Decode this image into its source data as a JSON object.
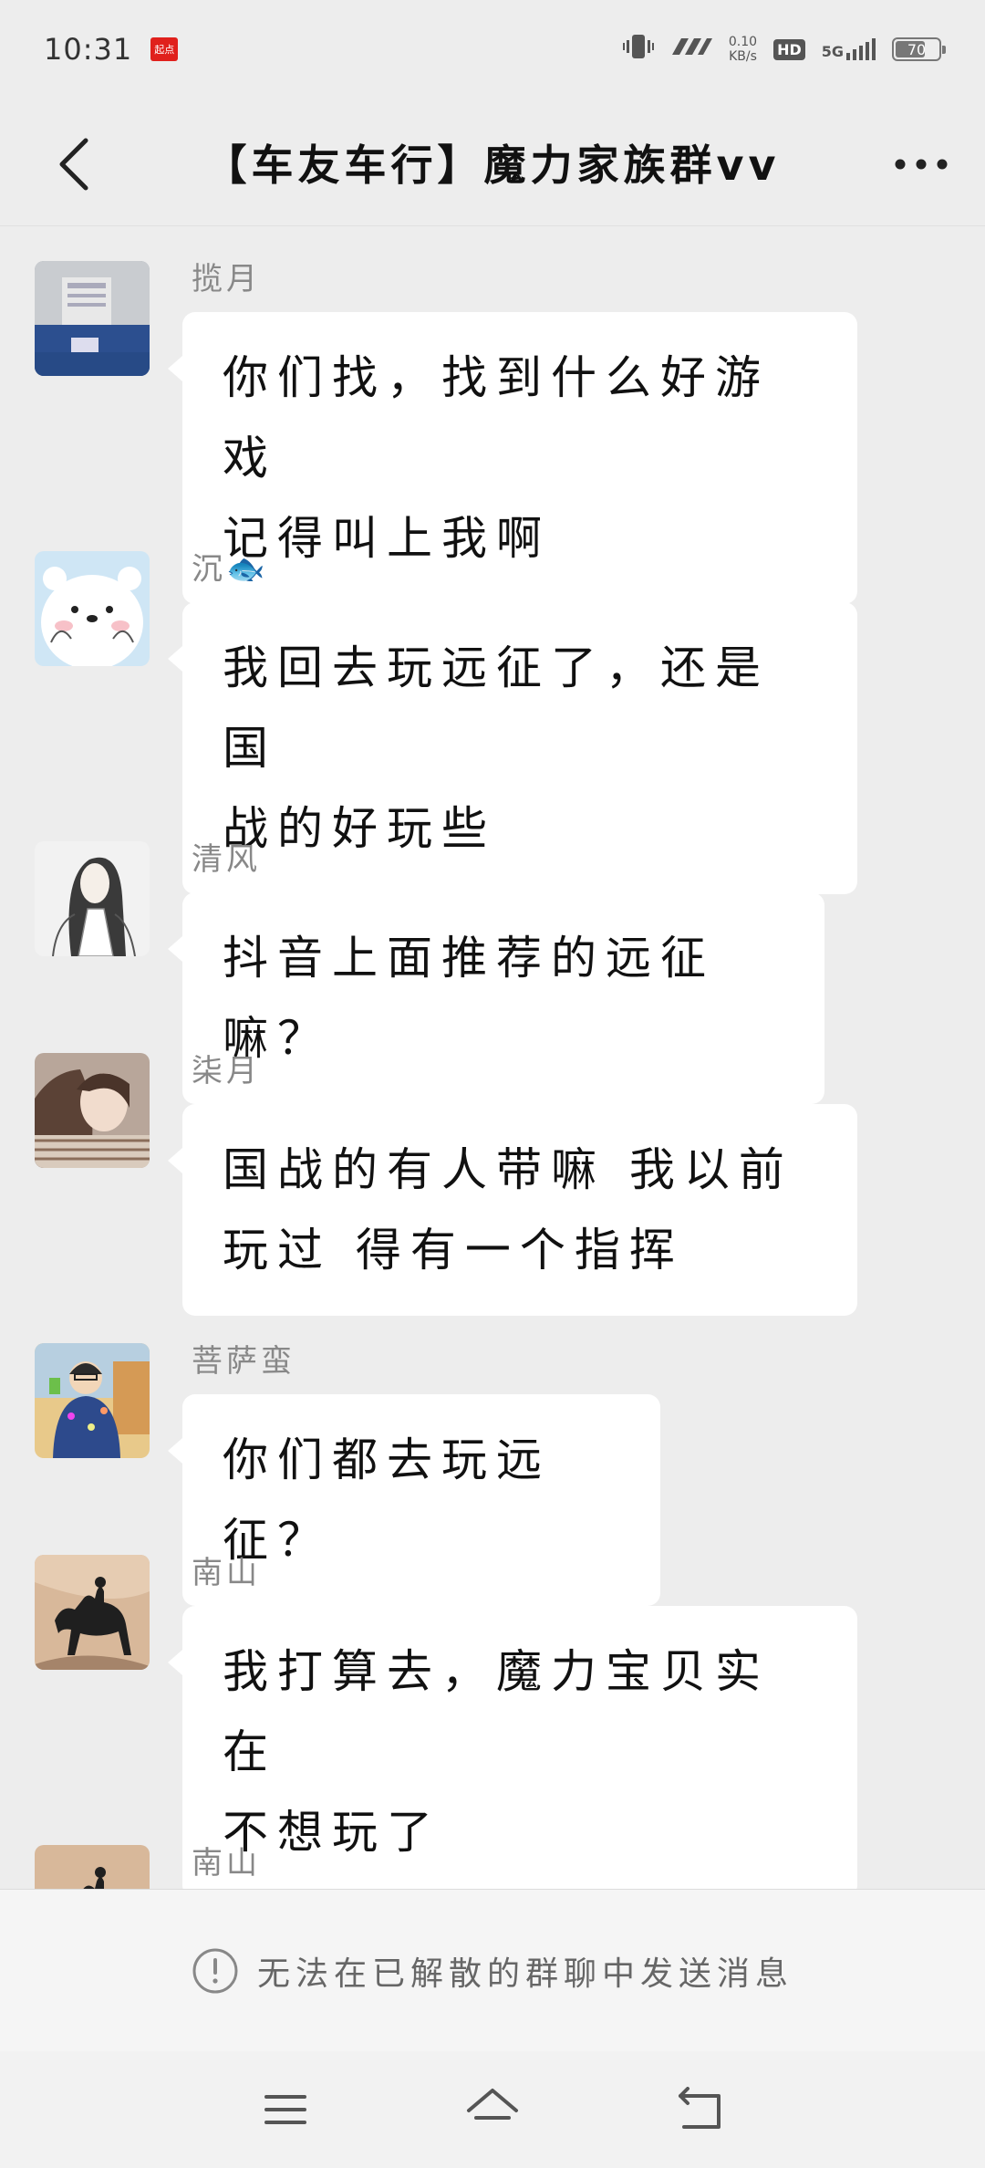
{
  "status": {
    "time": "10:31",
    "app_badge": "起点",
    "net_speed_value": "0.10",
    "net_speed_unit": "KB/s",
    "hd": "HD",
    "network": "5G",
    "battery": "70",
    "battery_level": 0.7
  },
  "header": {
    "title": "【车友车行】魔力家族群vv"
  },
  "messages": [
    {
      "sender": "揽月",
      "lines": [
        "你们找，找到什么好游戏",
        "记得叫上我啊"
      ]
    },
    {
      "sender": "沉🐟",
      "lines": [
        "我回去玩远征了，还是国",
        "战的好玩些"
      ]
    },
    {
      "sender": "清风",
      "lines": [
        "抖音上面推荐的远征嘛？"
      ]
    },
    {
      "sender": "柒月",
      "lines": [
        "国战的有人带嘛  我以前",
        "玩过  得有一个指挥"
      ]
    },
    {
      "sender": "菩萨蛮",
      "lines": [
        "你们都去玩远征？"
      ]
    },
    {
      "sender": "南山",
      "lines": [
        "我打算去，魔力宝贝实在",
        "不想玩了"
      ]
    },
    {
      "sender": "南山",
      "lines": []
    }
  ],
  "notice": {
    "text": "无法在已解散的群聊中发送消息"
  }
}
